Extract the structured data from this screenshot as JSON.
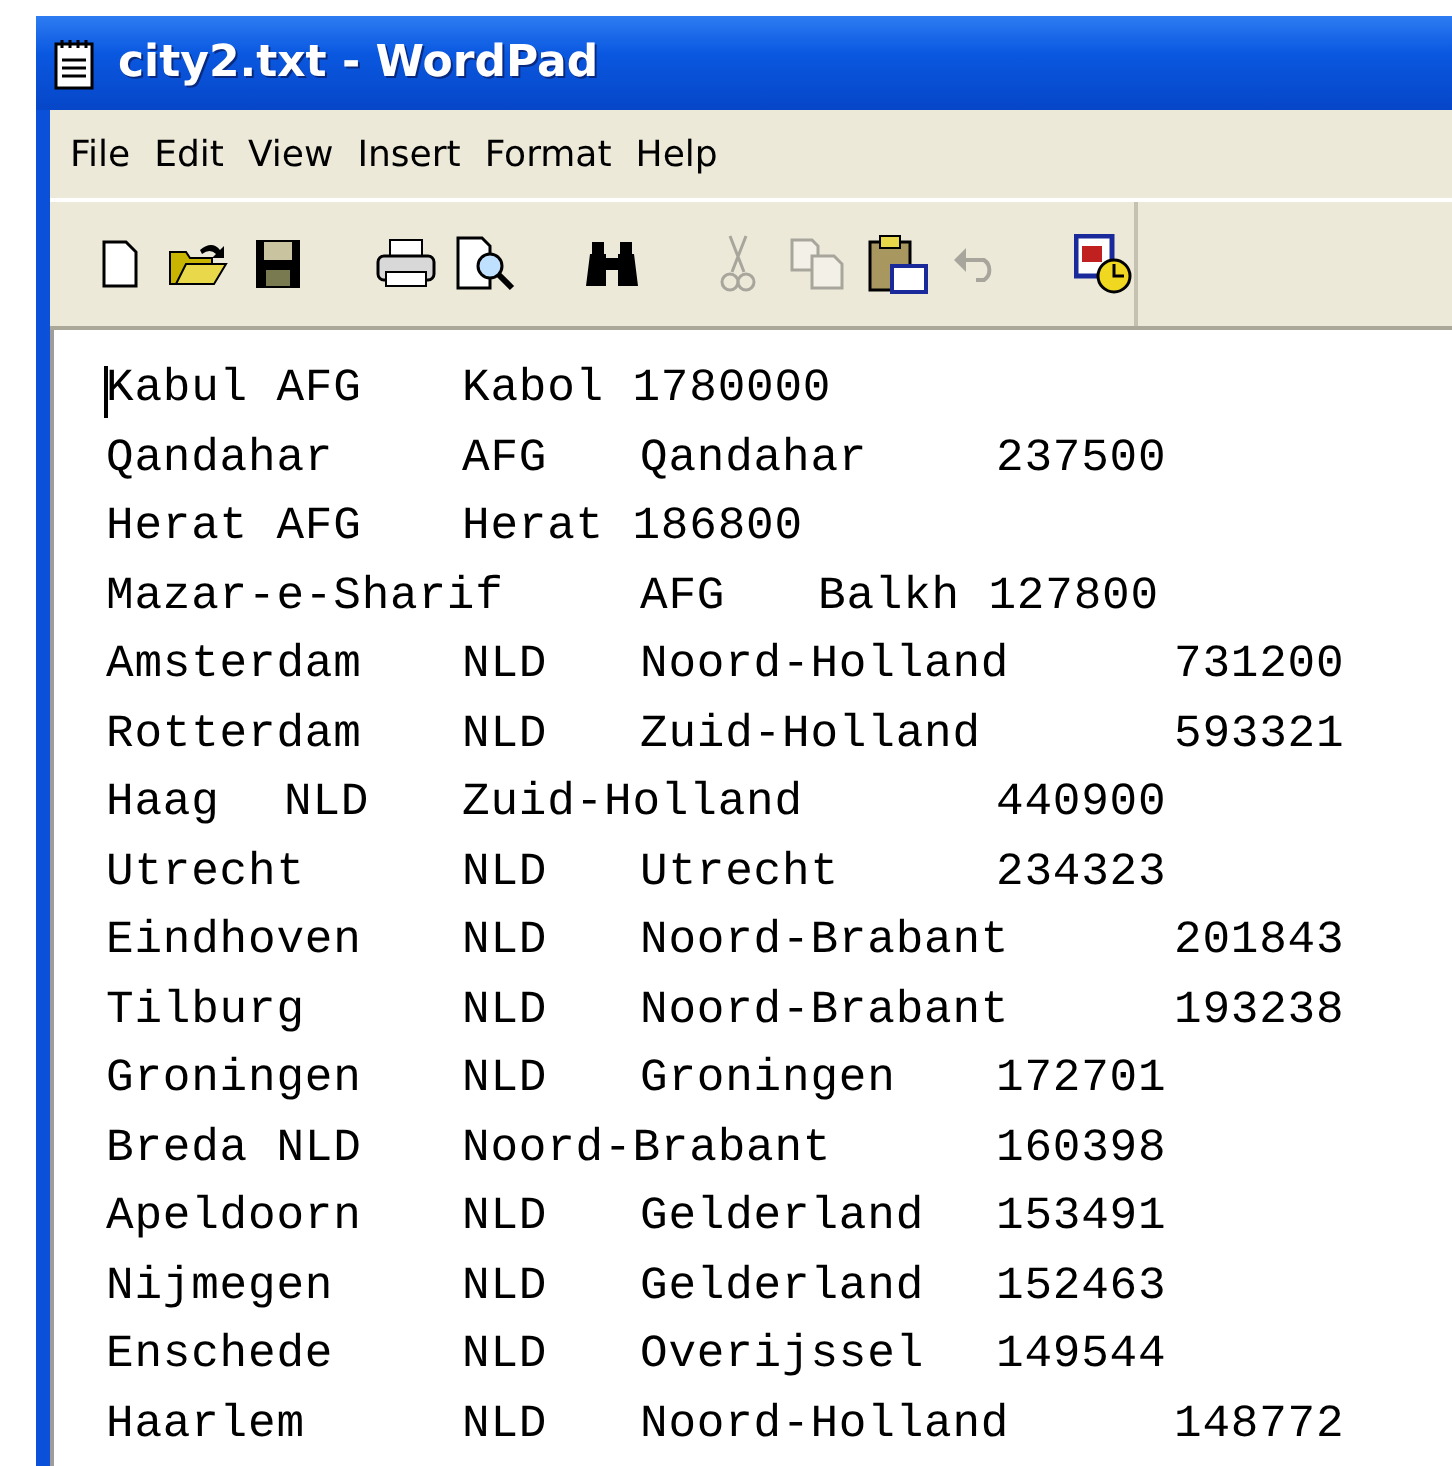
{
  "window": {
    "title": "city2.txt - WordPad"
  },
  "menu": [
    "File",
    "Edit",
    "View",
    "Insert",
    "Format",
    "Help"
  ],
  "toolbar": [
    {
      "kind": "new",
      "disabled": false
    },
    {
      "kind": "open",
      "disabled": false
    },
    {
      "kind": "save",
      "disabled": false
    },
    {
      "kind": "gap"
    },
    {
      "kind": "print",
      "disabled": false
    },
    {
      "kind": "preview",
      "disabled": false
    },
    {
      "kind": "gap"
    },
    {
      "kind": "find",
      "disabled": false
    },
    {
      "kind": "gap"
    },
    {
      "kind": "cut",
      "disabled": true
    },
    {
      "kind": "copy",
      "disabled": true
    },
    {
      "kind": "paste",
      "disabled": false
    },
    {
      "kind": "undo",
      "disabled": true
    },
    {
      "kind": "gap"
    },
    {
      "kind": "datetime",
      "disabled": false
    }
  ],
  "document": {
    "lines": [
      "Kabul AFG\tKabol 1780000",
      "Qandahar\tAFG\tQandahar\t237500",
      "Herat AFG\tHerat 186800",
      "Mazar-e-Sharif\tAFG\tBalkh 127800",
      "Amsterdam\tNLD\tNoord-Holland\t731200",
      "Rotterdam\tNLD\tZuid-Holland\t\t593321",
      "Haag\tNLD\tZuid-Holland\t\t440900",
      "Utrecht\tNLD\tUtrecht\t234323",
      "Eindhoven\tNLD\tNoord-Brabant\t201843",
      "Tilburg\tNLD\tNoord-Brabant\t193238",
      "Groningen\tNLD\tGroningen\t172701",
      "Breda NLD\tNoord-Brabant\t160398",
      "Apeldoorn\tNLD\tGelderland\t153491",
      "Nijmegen\tNLD\tGelderland\t152463",
      "Enschede\tNLD\tOverijssel\t149544",
      "Haarlem\tNLD\tNoord-Holland\t148772"
    ]
  }
}
